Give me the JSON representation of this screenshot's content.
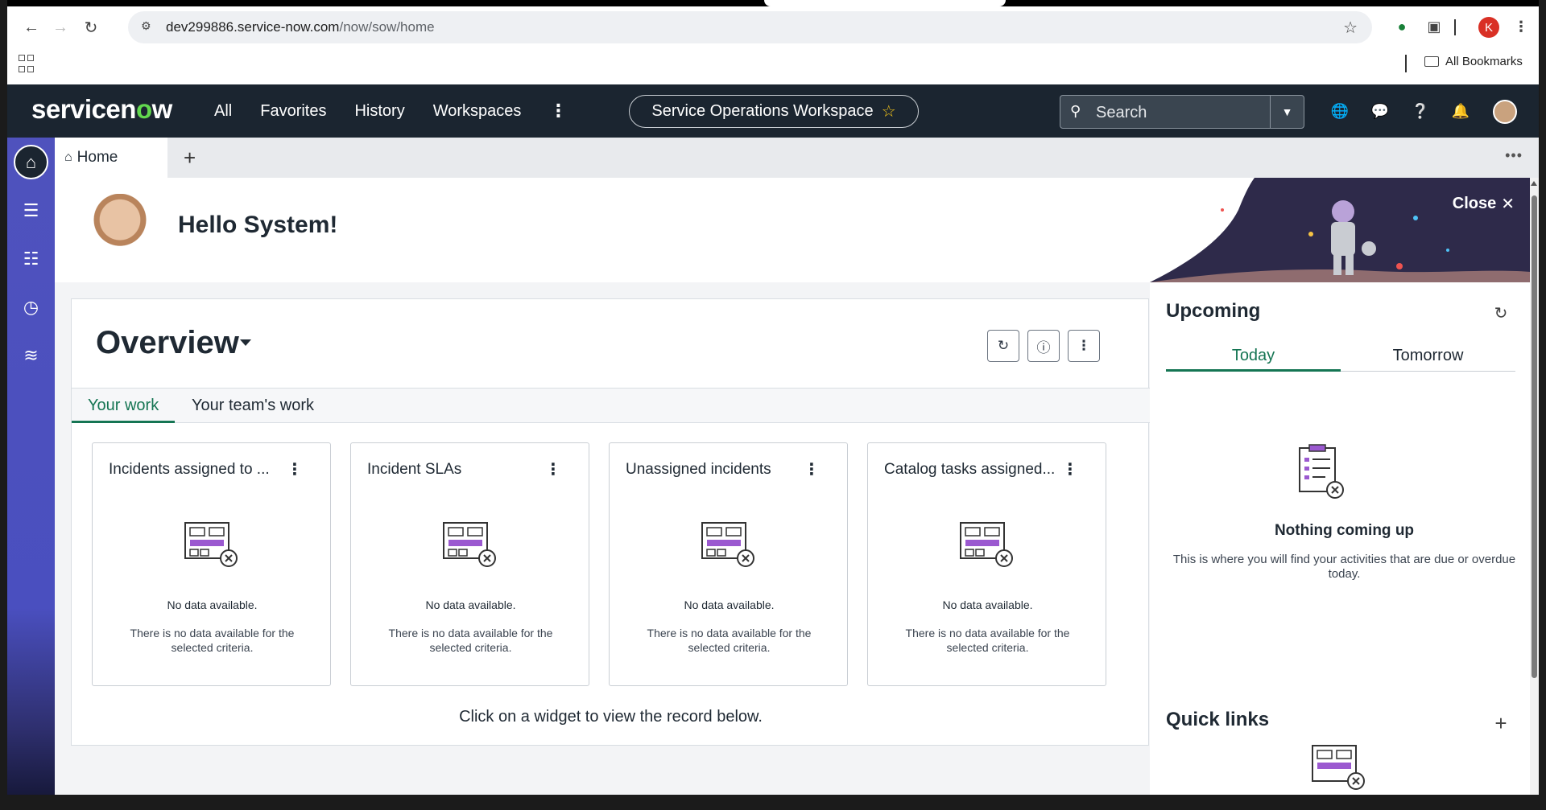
{
  "browser": {
    "url_domain": "dev299886.service-now.com",
    "url_path": "/now/sow/home",
    "profile_initial": "K",
    "all_bookmarks": "All Bookmarks"
  },
  "header": {
    "logo_prefix": "servicen",
    "logo_o": "o",
    "logo_suffix": "w",
    "nav": [
      "All",
      "Favorites",
      "History",
      "Workspaces"
    ],
    "workspace_title": "Service Operations Workspace",
    "search_placeholder": "Search"
  },
  "tabs": {
    "home_label": "Home"
  },
  "greeting": {
    "text": "Hello System!",
    "close_label": "Close"
  },
  "overview": {
    "title": "Overview",
    "tabs": [
      "Your work",
      "Your team's work"
    ],
    "widgets": [
      {
        "title": "Incidents assigned to ...",
        "nodata": "No data available.",
        "desc": "There is no data available for the selected criteria."
      },
      {
        "title": "Incident SLAs",
        "nodata": "No data available.",
        "desc": "There is no data available for the selected criteria."
      },
      {
        "title": "Unassigned incidents",
        "nodata": "No data available.",
        "desc": "There is no data available for the selected criteria."
      },
      {
        "title": "Catalog tasks assigned...",
        "nodata": "No data available.",
        "desc": "There is no data available for the selected criteria."
      }
    ],
    "footer": "Click on a widget to view the record below."
  },
  "upcoming": {
    "title": "Upcoming",
    "tabs": [
      "Today",
      "Tomorrow"
    ],
    "empty_title": "Nothing coming up",
    "empty_desc": "This is where you will find your activities that are due or overdue today."
  },
  "quick_links": {
    "title": "Quick links"
  },
  "colors": {
    "header_bg": "#1b2530",
    "left_nav": "#4f52bd",
    "accent_green": "#157553",
    "logo_green": "#62d84e"
  }
}
